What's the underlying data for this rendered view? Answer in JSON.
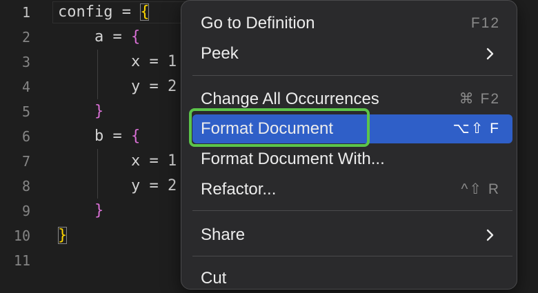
{
  "editor": {
    "lines": [
      {
        "num": "1",
        "parts": [
          "config = ",
          "{",
          ""
        ]
      },
      {
        "num": "2",
        "parts": [
          "    a = ",
          "{",
          ""
        ]
      },
      {
        "num": "3",
        "parts": [
          "        x = 1",
          "",
          ""
        ]
      },
      {
        "num": "4",
        "parts": [
          "        y = 2",
          "",
          ""
        ]
      },
      {
        "num": "5",
        "parts": [
          "    ",
          "}",
          ""
        ]
      },
      {
        "num": "6",
        "parts": [
          "    b = ",
          "{",
          ""
        ]
      },
      {
        "num": "7",
        "parts": [
          "        x = 1",
          "",
          ""
        ]
      },
      {
        "num": "8",
        "parts": [
          "        y = 2",
          "",
          ""
        ]
      },
      {
        "num": "9",
        "parts": [
          "    ",
          "}",
          ""
        ]
      },
      {
        "num": "10",
        "parts": [
          "",
          "}",
          ""
        ]
      },
      {
        "num": "11",
        "parts": [
          "",
          "",
          ""
        ]
      }
    ]
  },
  "context_menu": {
    "items": [
      {
        "label": "Go to Definition",
        "shortcut": "F12"
      },
      {
        "label": "Peek",
        "shortcut": ""
      },
      {
        "label": "Change All Occurrences",
        "shortcut": "⌘ F2"
      },
      {
        "label": "Format Document",
        "shortcut": "⌥⇧ F"
      },
      {
        "label": "Format Document With...",
        "shortcut": ""
      },
      {
        "label": "Refactor...",
        "shortcut": "^⇧ R"
      },
      {
        "label": "Share",
        "shortcut": ""
      },
      {
        "label": "Cut",
        "shortcut": ""
      }
    ],
    "selected_item": "Format Document"
  },
  "colors": {
    "editor_bg": "#1e1e1e",
    "menu_bg": "#2a2a2c",
    "selection": "#2f5fc8",
    "highlight_outline": "#5cc54a",
    "brace_level1": "#ffd700",
    "brace_level2": "#da70d6"
  },
  "icons": [
    "chevron-right-icon"
  ]
}
